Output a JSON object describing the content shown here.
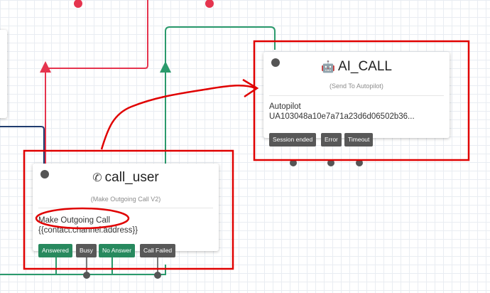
{
  "colors": {
    "red_annotation": "#e00000",
    "green_wire": "#2b9a6c",
    "red_wire": "#e5344e",
    "navy_wire": "#1f3c6e",
    "grey_wire": "#7a7a7a"
  },
  "ai_call": {
    "icon": "robot-icon",
    "title": "AI_CALL",
    "subtitle": "(Send To Autopilot)",
    "body_label": "Autopilot",
    "body_value": "UA103048a10e7a71a23d6d06502b36...",
    "transitions": [
      "Session ended",
      "Error",
      "Timeout"
    ]
  },
  "call_user": {
    "icon": "phone-icon",
    "title": "call_user",
    "subtitle": "(Make Outgoing Call V2)",
    "body_label": "Make Outgoing Call",
    "body_value": "{{contact.channel.address}}",
    "transitions": [
      "Answered",
      "Busy",
      "No Answer",
      "Call Failed"
    ]
  }
}
